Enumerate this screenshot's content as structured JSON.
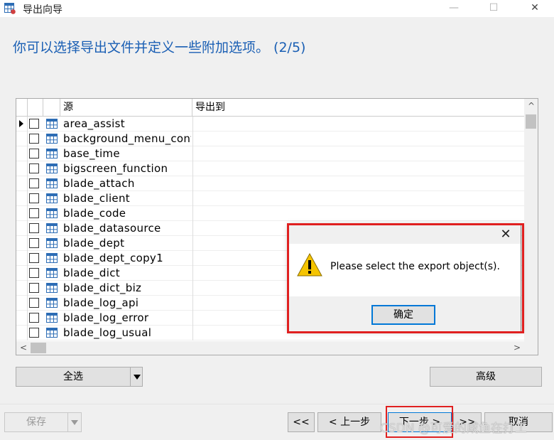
{
  "window": {
    "title": "导出向导",
    "minimize_glyph": "—",
    "maximize_glyph": "☐",
    "close_glyph": "✕"
  },
  "heading": "你可以选择导出文件并定义一些附加选项。 (2/5)",
  "grid": {
    "columns": [
      "源",
      "导出到"
    ],
    "rows": [
      "area_assist",
      "background_menu_config",
      "base_time",
      "bigscreen_function",
      "blade_attach",
      "blade_client",
      "blade_code",
      "blade_datasource",
      "blade_dept",
      "blade_dept_copy1",
      "blade_dict",
      "blade_dict_biz",
      "blade_log_api",
      "blade_log_error",
      "blade_log_usual"
    ],
    "scroll_left_glyph": "<",
    "scroll_right_glyph": ">",
    "scroll_up_glyph": "^"
  },
  "buttons": {
    "select_all": "全选",
    "advanced": "高级",
    "save": "保存",
    "first": "<<",
    "prev": "< 上一步",
    "next": "下一步 >",
    "next_extra": ">>",
    "cancel": "取消"
  },
  "dialog": {
    "message": "Please select the export object(s).",
    "ok": "确定",
    "close_glyph": "✕"
  },
  "watermark": "CSDN @可爱的咸鱼在打工",
  "colors": {
    "heading": "#1a5fb4",
    "highlight": "#e02020",
    "focus": "#0078d7",
    "warning": "#f5c400"
  },
  "icons": {
    "app": "table-export-icon",
    "row": "table-icon",
    "dialog": "warning-icon"
  }
}
